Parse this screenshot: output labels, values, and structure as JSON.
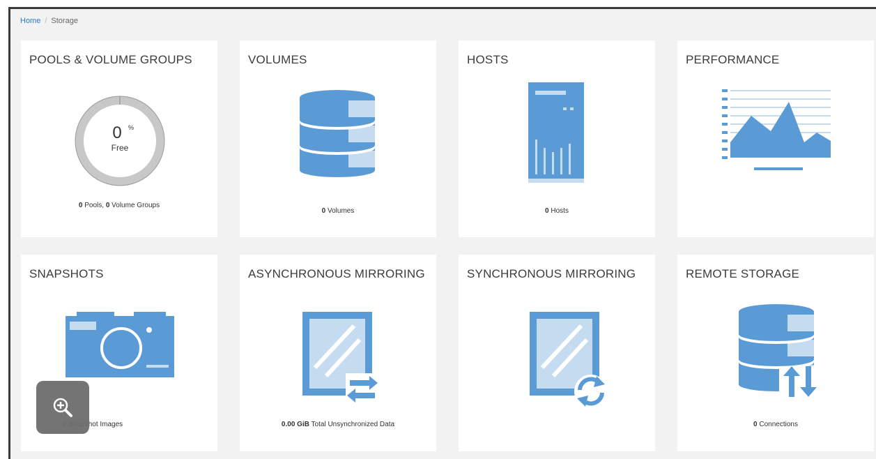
{
  "breadcrumb": {
    "home": "Home",
    "separator": "/",
    "current": "Storage"
  },
  "tiles": {
    "pools": {
      "title": "POOLS & VOLUME GROUPS",
      "donut": {
        "value": "0",
        "unit": "%",
        "label": "Free",
        "free_fraction": 0
      },
      "footer_count1": "0",
      "footer_text1": " Pools, ",
      "footer_count2": "0",
      "footer_text2": " Volume Groups"
    },
    "volumes": {
      "title": "VOLUMES",
      "footer_count": "0",
      "footer_text": " Volumes"
    },
    "hosts": {
      "title": "HOSTS",
      "footer_count": "0",
      "footer_text": " Hosts"
    },
    "performance": {
      "title": "PERFORMANCE"
    },
    "snapshots": {
      "title": "SNAPSHOTS",
      "footer_count": "0",
      "footer_text": " Snapshot Images"
    },
    "async": {
      "title": "ASYNCHRONOUS MIRRORING",
      "footer_value": "0.00 GiB",
      "footer_text": " Total Unsynchronized Data"
    },
    "sync": {
      "title": "SYNCHRONOUS MIRRORING"
    },
    "remote": {
      "title": "REMOTE STORAGE",
      "footer_count": "0",
      "footer_text": " Connections"
    }
  },
  "colors": {
    "icon_blue": "#5b9bd5",
    "icon_light": "#c5dcf0",
    "link": "#2a7bc6"
  },
  "icons": [
    "zoom-in-icon",
    "database-icon",
    "server-icon",
    "chart-icon",
    "camera-icon",
    "mirror-icon",
    "sync-icon",
    "transfer-icon"
  ]
}
